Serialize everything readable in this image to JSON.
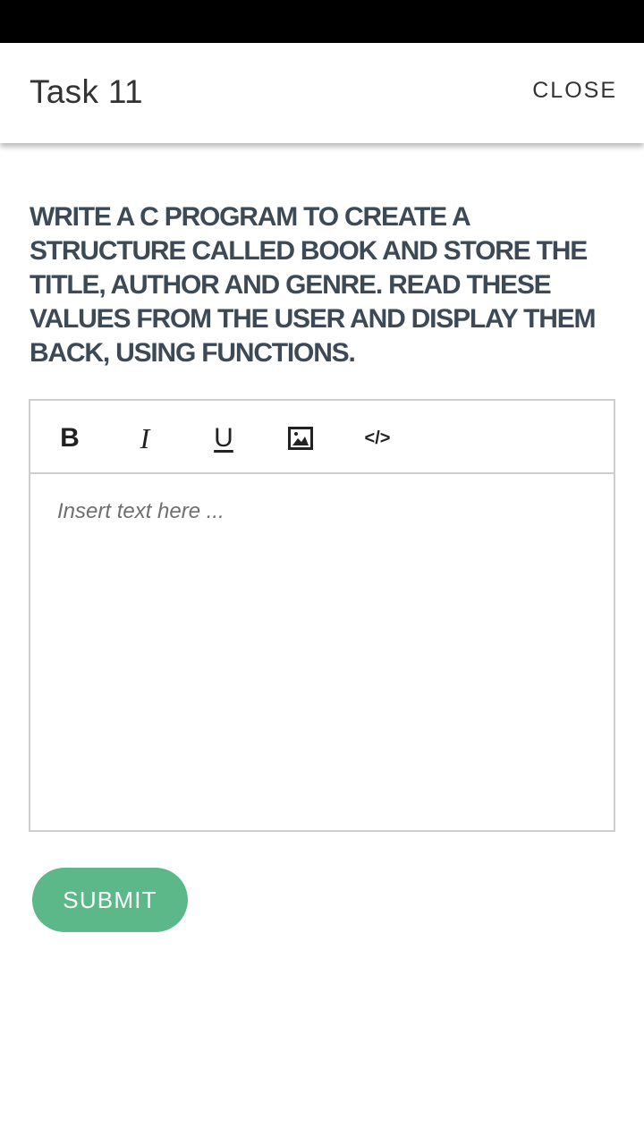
{
  "header": {
    "title": "Task 11",
    "close_label": "CLOSE"
  },
  "question": {
    "text": "WRITE A C PROGRAM TO CREATE A STRUCTURE CALLED BOOK AND STORE THE TITLE, AUTHOR AND GENRE. READ THESE VALUES FROM THE USER AND DISPLAY THEM BACK, USING FUNCTIONS."
  },
  "editor": {
    "toolbar": {
      "bold_label": "B",
      "italic_label": "I",
      "underline_label": "U",
      "code_label": "</>"
    },
    "placeholder": "Insert text here ..."
  },
  "actions": {
    "submit_label": "SUBMIT"
  },
  "colors": {
    "accent": "#5cb889",
    "text_dark": "#333333",
    "question_text": "#3d4a56",
    "border": "#cfcfcf"
  },
  "icons": [
    "bold-icon",
    "italic-icon",
    "underline-icon",
    "image-icon",
    "code-icon"
  ]
}
